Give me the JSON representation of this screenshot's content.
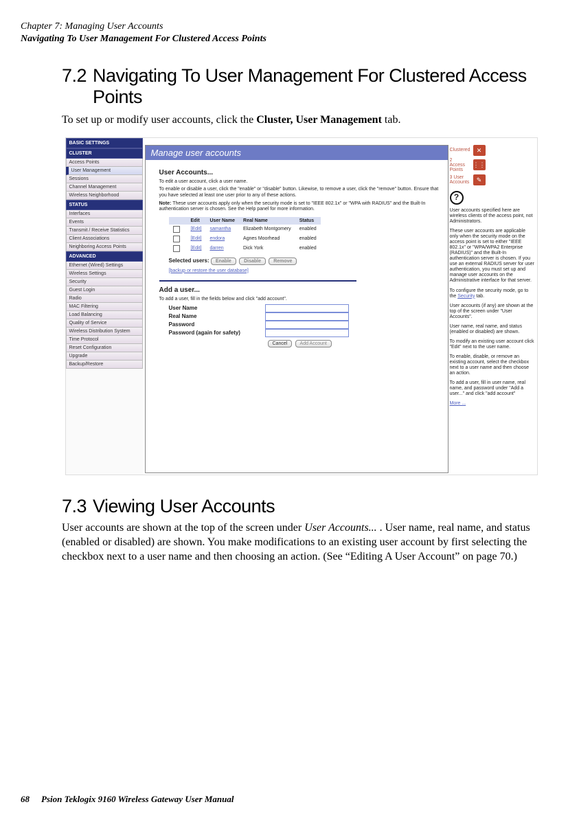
{
  "header": {
    "line1": "Chapter 7:  Managing User Accounts",
    "line2": "Navigating To User Management For Clustered Access Points"
  },
  "section72": {
    "num": "7.2",
    "title": "Navigating To User Management For Clustered Access Points",
    "body_part1": "To set up or modify user accounts, click the ",
    "body_bold": "Cluster, User Management",
    "body_part2": " tab."
  },
  "section73": {
    "num": "7.3",
    "title": "Viewing User Accounts",
    "body_part1": "User accounts are shown at the top of the screen under ",
    "body_italic": "User Accounts...",
    "body_part2": " . User name, real name, and status (enabled or disabled) are shown. You make modifications to an existing user account by first selecting the checkbox next to a user name and then choosing an action. (See “Editing A User Account” on page 70.)"
  },
  "footer": {
    "pagenum": "68",
    "text": "Psion Teklogix 9160 Wireless Gateway User Manual"
  },
  "screenshot": {
    "sidebar": {
      "groups": [
        {
          "head": "BASIC SETTINGS",
          "items": []
        },
        {
          "head": "CLUSTER",
          "items": [
            "Access Points",
            "User Management",
            "Sessions",
            "Channel Management",
            "Wireless Neighborhood"
          ]
        },
        {
          "head": "STATUS",
          "items": [
            "Interfaces",
            "Events",
            "Transmit / Receive Statistics",
            "Client Associations",
            "Neighboring Access Points"
          ]
        },
        {
          "head": "ADVANCED",
          "items": [
            "Ethernet (Wired) Settings",
            "Wireless Settings",
            "Security",
            "Guest Login",
            "Radio",
            "MAC Filtering",
            "Load Balancing",
            "Quality of Service",
            "Wireless Distribution System",
            "Time Protocol",
            "Reset Configuration",
            "Upgrade",
            "Backup/Restore"
          ]
        }
      ]
    },
    "banner": "Manage user accounts",
    "content": {
      "h1": "User Accounts...",
      "p1": "To edit a user account, click a user name.",
      "p2": "To enable or disable a user, click the \"enable\" or \"disable\" button. Likewise, to remove a user, click the \"remove\" button. Ensure that you have selected at least one user prior to any of these actions.",
      "noteLabel": "Note:",
      "noteText": " These user accounts apply only when the security mode is set to \"IEEE 802.1x\" or \"WPA with RADIUS\" and the Built-In authentication server is chosen. See the Help panel for more information.",
      "tableHeaders": [
        "Edit",
        "User Name",
        "Real Name",
        "Status"
      ],
      "tableRows": [
        {
          "edit": "[Edit]",
          "user": "samantha",
          "real": "Elizabeth Montgomery",
          "status": "enabled"
        },
        {
          "edit": "[Edit]",
          "user": "endora",
          "real": "Agnes Moorhead",
          "status": "enabled"
        },
        {
          "edit": "[Edit]",
          "user": "darren",
          "real": "Dick York",
          "status": "enabled"
        }
      ],
      "selectedLabel": "Selected users:",
      "btns": {
        "enable": "Enable",
        "disable": "Disable",
        "remove": "Remove"
      },
      "backupLink": "[backup or restore the user database]",
      "h2": "Add a user...",
      "p3": "To add a user, fill in the fields below and click \"add account\".",
      "form": {
        "userName": "User Name",
        "realName": "Real Name",
        "password": "Password",
        "password2": "Password (again for safety)",
        "cancel": "Cancel",
        "addAccount": "Add Account"
      }
    },
    "right": {
      "badges": [
        {
          "line1": "Clustered",
          "line2": "",
          "icon": "✕"
        },
        {
          "line1": "2",
          "line2": "Access Points",
          "icon": "⋮⋮"
        },
        {
          "line1": "3 User",
          "line2": "Accounts",
          "icon": "✎"
        }
      ],
      "questionMark": "?",
      "help": [
        "User accounts specified here are wireless clients of the access point, not Administrators.",
        "These user accounts are applicable only when the security mode on the access point is set to either \"IEEE 802.1x\" or \"WPA/WPA2 Enterprise (RADIUS)\" and the Built-In authentication server is chosen. If you use an external RADIUS server for user authentication, you must set up and manage user accounts on the Administrative interface for that server.",
        "",
        "User accounts (if any) are shown at the top of the screen under \"User Accounts\".",
        "User name, real name, and status (enabled or disabled) are shown.",
        "To modify an existing user account click \"Edit\" next to the user name.",
        "To enable, disable, or remove an existing account, select the checkbox next to a user name and then choose an action.",
        "To add a user, fill in user name, real name, and password under \"Add a user...\" and click \"add account\""
      ],
      "secLinkPrefix": "To configure the security mode, go to the ",
      "secLink": "Security",
      "secLinkSuffix": " tab.",
      "more": "More ..."
    }
  }
}
